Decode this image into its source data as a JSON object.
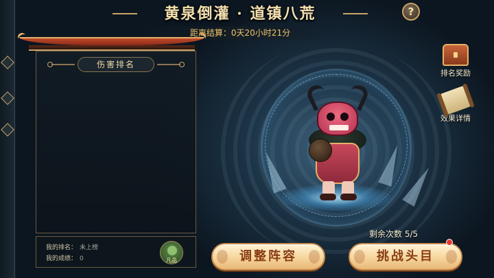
{
  "header": {
    "title": "黄泉倒灌 · 道镇八荒",
    "countdown": "距离结算：0天20小时21分",
    "help_icon": "question-mark-icon"
  },
  "rank_panel": {
    "header": "伤害排名"
  },
  "my_info": {
    "rank_label": "我的排名：",
    "rank_value": "未上榜",
    "score_label": "我的成绩：",
    "score_value": "0",
    "avatar_tag": "凡品"
  },
  "side_buttons": [
    {
      "label": "排名奖励",
      "icon": "treasure-chest-icon"
    },
    {
      "label": "效果详情",
      "icon": "scroll-icon"
    }
  ],
  "remaining": "剩余次数  5/5",
  "buttons": {
    "adjust": "调整阵容",
    "challenge": "挑战头目"
  },
  "colors": {
    "accent_gold": "#c9a46a",
    "button_text": "#8a3c14",
    "countdown": "#f1c46a",
    "notify_dot": "#e8382c"
  }
}
